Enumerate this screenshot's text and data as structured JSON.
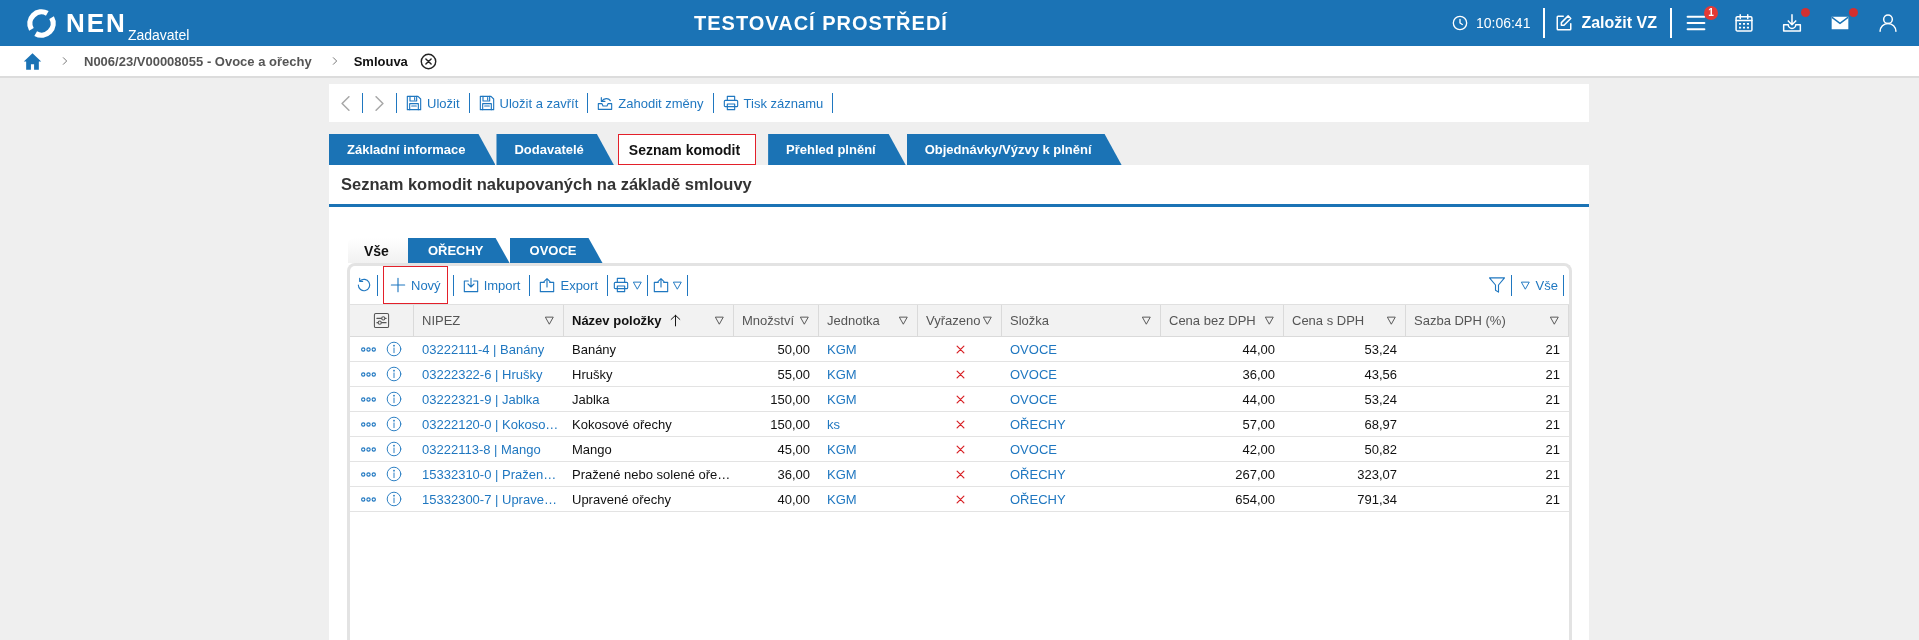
{
  "header": {
    "logo": {
      "text": "NEN",
      "subtitle": "Zadavatel"
    },
    "environment": "TESTOVACÍ PROSTŘEDÍ",
    "time": "10:06:41",
    "create_button": "Založit VZ",
    "icons": [
      {
        "kind": "menu",
        "badge": "1",
        "dot": false
      },
      {
        "kind": "calendar",
        "dot": false
      },
      {
        "kind": "download",
        "dot": true
      },
      {
        "kind": "mail",
        "dot": true
      },
      {
        "kind": "user",
        "dot": false
      }
    ]
  },
  "breadcrumb": [
    {
      "label": "N006/23/V00008055 - Ovoce a ořechy",
      "current": false
    },
    {
      "label": "Smlouva",
      "current": true
    }
  ],
  "toolbar": {
    "items": [
      {
        "kind": "back",
        "disabled": true
      },
      {
        "kind": "forward",
        "disabled": true
      },
      {
        "kind": "save",
        "label": "Uložit",
        "disabled": false
      },
      {
        "kind": "save_close",
        "label": "Uložit a zavřít",
        "disabled": false
      },
      {
        "kind": "discard",
        "label": "Zahodit změny",
        "disabled": false
      },
      {
        "kind": "print",
        "label": "Tisk záznamu",
        "disabled": false
      }
    ]
  },
  "tabs": [
    {
      "label": "Základní informace",
      "selected": false,
      "highlighted": false
    },
    {
      "label": "Dodavatelé",
      "selected": false,
      "highlighted": false
    },
    {
      "label": "Seznam komodit",
      "selected": true,
      "highlighted": true
    },
    {
      "label": "Přehled plnění",
      "selected": false,
      "highlighted": false
    },
    {
      "label": "Objednávky/Výzvy k plnění",
      "selected": false,
      "highlighted": false
    }
  ],
  "section": {
    "title": "Seznam komodit nakupovaných na základě smlouvy"
  },
  "sub_tabs": [
    {
      "label": "Vše",
      "selected": true
    },
    {
      "label": "OŘECHY",
      "selected": false
    },
    {
      "label": "OVOCE",
      "selected": false
    }
  ],
  "grid": {
    "toolbar": {
      "items": [
        {
          "kind": "refresh",
          "highlighted": false
        },
        {
          "kind": "new",
          "label": "Nový",
          "highlighted": true
        },
        {
          "kind": "import",
          "label": "Import",
          "highlighted": false
        },
        {
          "kind": "export",
          "label": "Export",
          "highlighted": false
        },
        {
          "kind": "print_menu",
          "highlighted": false
        },
        {
          "kind": "share_menu",
          "highlighted": false
        }
      ],
      "view_filter": "Vše"
    },
    "columns": [
      {
        "label": "NIPEZ",
        "kind": "link",
        "sorted": false
      },
      {
        "label": "Název položky",
        "kind": "text",
        "sorted": true
      },
      {
        "label": "Množství",
        "kind": "number",
        "sorted": false
      },
      {
        "label": "Jednotka",
        "kind": "link",
        "sorted": false
      },
      {
        "label": "Vyřazeno",
        "kind": "flag",
        "sorted": false
      },
      {
        "label": "Složka",
        "kind": "link",
        "sorted": false
      },
      {
        "label": "Cena bez DPH",
        "kind": "number",
        "sorted": false
      },
      {
        "label": "Cena s DPH",
        "kind": "number",
        "sorted": false
      },
      {
        "label": "Sazba DPH (%)",
        "kind": "number",
        "sorted": false
      }
    ],
    "rows": [
      {
        "nipez": "03222111-4 | Banány",
        "name": "Banány",
        "quantity": "50,00",
        "unit": "KGM",
        "discarded": false,
        "folder": "OVOCE",
        "price_excl_vat": "44,00",
        "price_incl_vat": "53,24",
        "vat_rate": "21"
      },
      {
        "nipez": "03222322-6 | Hrušky",
        "name": "Hrušky",
        "quantity": "55,00",
        "unit": "KGM",
        "discarded": false,
        "folder": "OVOCE",
        "price_excl_vat": "36,00",
        "price_incl_vat": "43,56",
        "vat_rate": "21"
      },
      {
        "nipez": "03222321-9 | Jablka",
        "name": "Jablka",
        "quantity": "150,00",
        "unit": "KGM",
        "discarded": false,
        "folder": "OVOCE",
        "price_excl_vat": "44,00",
        "price_incl_vat": "53,24",
        "vat_rate": "21"
      },
      {
        "nipez": "03222120-0 | Kokoso…",
        "name": "Kokosové ořechy",
        "quantity": "150,00",
        "unit": "ks",
        "discarded": false,
        "folder": "OŘECHY",
        "price_excl_vat": "57,00",
        "price_incl_vat": "68,97",
        "vat_rate": "21"
      },
      {
        "nipez": "03222113-8 | Mango",
        "name": "Mango",
        "quantity": "45,00",
        "unit": "KGM",
        "discarded": false,
        "folder": "OVOCE",
        "price_excl_vat": "42,00",
        "price_incl_vat": "50,82",
        "vat_rate": "21"
      },
      {
        "nipez": "15332310-0 | Pražen…",
        "name": "Pražené nebo solené oře…",
        "quantity": "36,00",
        "unit": "KGM",
        "discarded": false,
        "folder": "OŘECHY",
        "price_excl_vat": "267,00",
        "price_incl_vat": "323,07",
        "vat_rate": "21"
      },
      {
        "nipez": "15332300-7 | Uprave…",
        "name": "Upravené ořechy",
        "quantity": "40,00",
        "unit": "KGM",
        "discarded": false,
        "folder": "OŘECHY",
        "price_excl_vat": "654,00",
        "price_incl_vat": "791,34",
        "vat_rate": "21"
      }
    ]
  }
}
